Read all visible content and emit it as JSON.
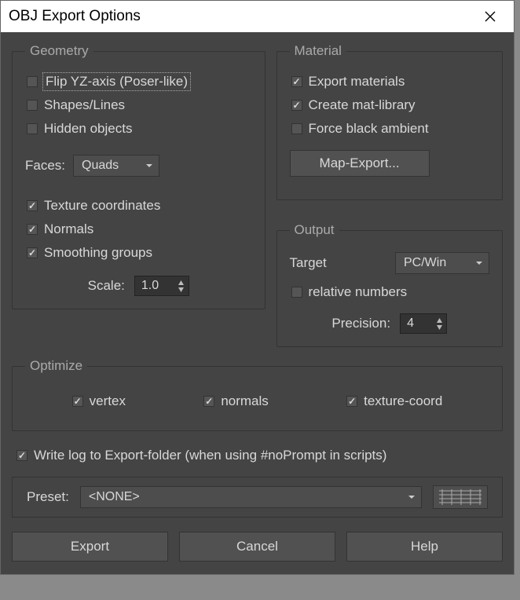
{
  "title": "OBJ Export Options",
  "geometry": {
    "legend": "Geometry",
    "flip_yz": "Flip YZ-axis (Poser-like)",
    "shapes_lines": "Shapes/Lines",
    "hidden_objects": "Hidden objects",
    "faces_label": "Faces:",
    "faces_value": "Quads",
    "texture_coords": "Texture coordinates",
    "normals": "Normals",
    "smoothing_groups": "Smoothing groups",
    "scale_label": "Scale:",
    "scale_value": "1.0"
  },
  "material": {
    "legend": "Material",
    "export_materials": "Export materials",
    "create_mat_library": "Create mat-library",
    "force_black_ambient": "Force black ambient",
    "map_export_btn": "Map-Export..."
  },
  "output": {
    "legend": "Output",
    "target_label": "Target",
    "target_value": "PC/Win",
    "relative_numbers": "relative numbers",
    "precision_label": "Precision:",
    "precision_value": "4"
  },
  "optimize": {
    "legend": "Optimize",
    "vertex": "vertex",
    "normals": "normals",
    "texture_coord": "texture-coord"
  },
  "log_label": "Write log to Export-folder (when using #noPrompt in scripts)",
  "preset": {
    "label": "Preset:",
    "value": "<NONE>"
  },
  "buttons": {
    "export": "Export",
    "cancel": "Cancel",
    "help": "Help"
  }
}
